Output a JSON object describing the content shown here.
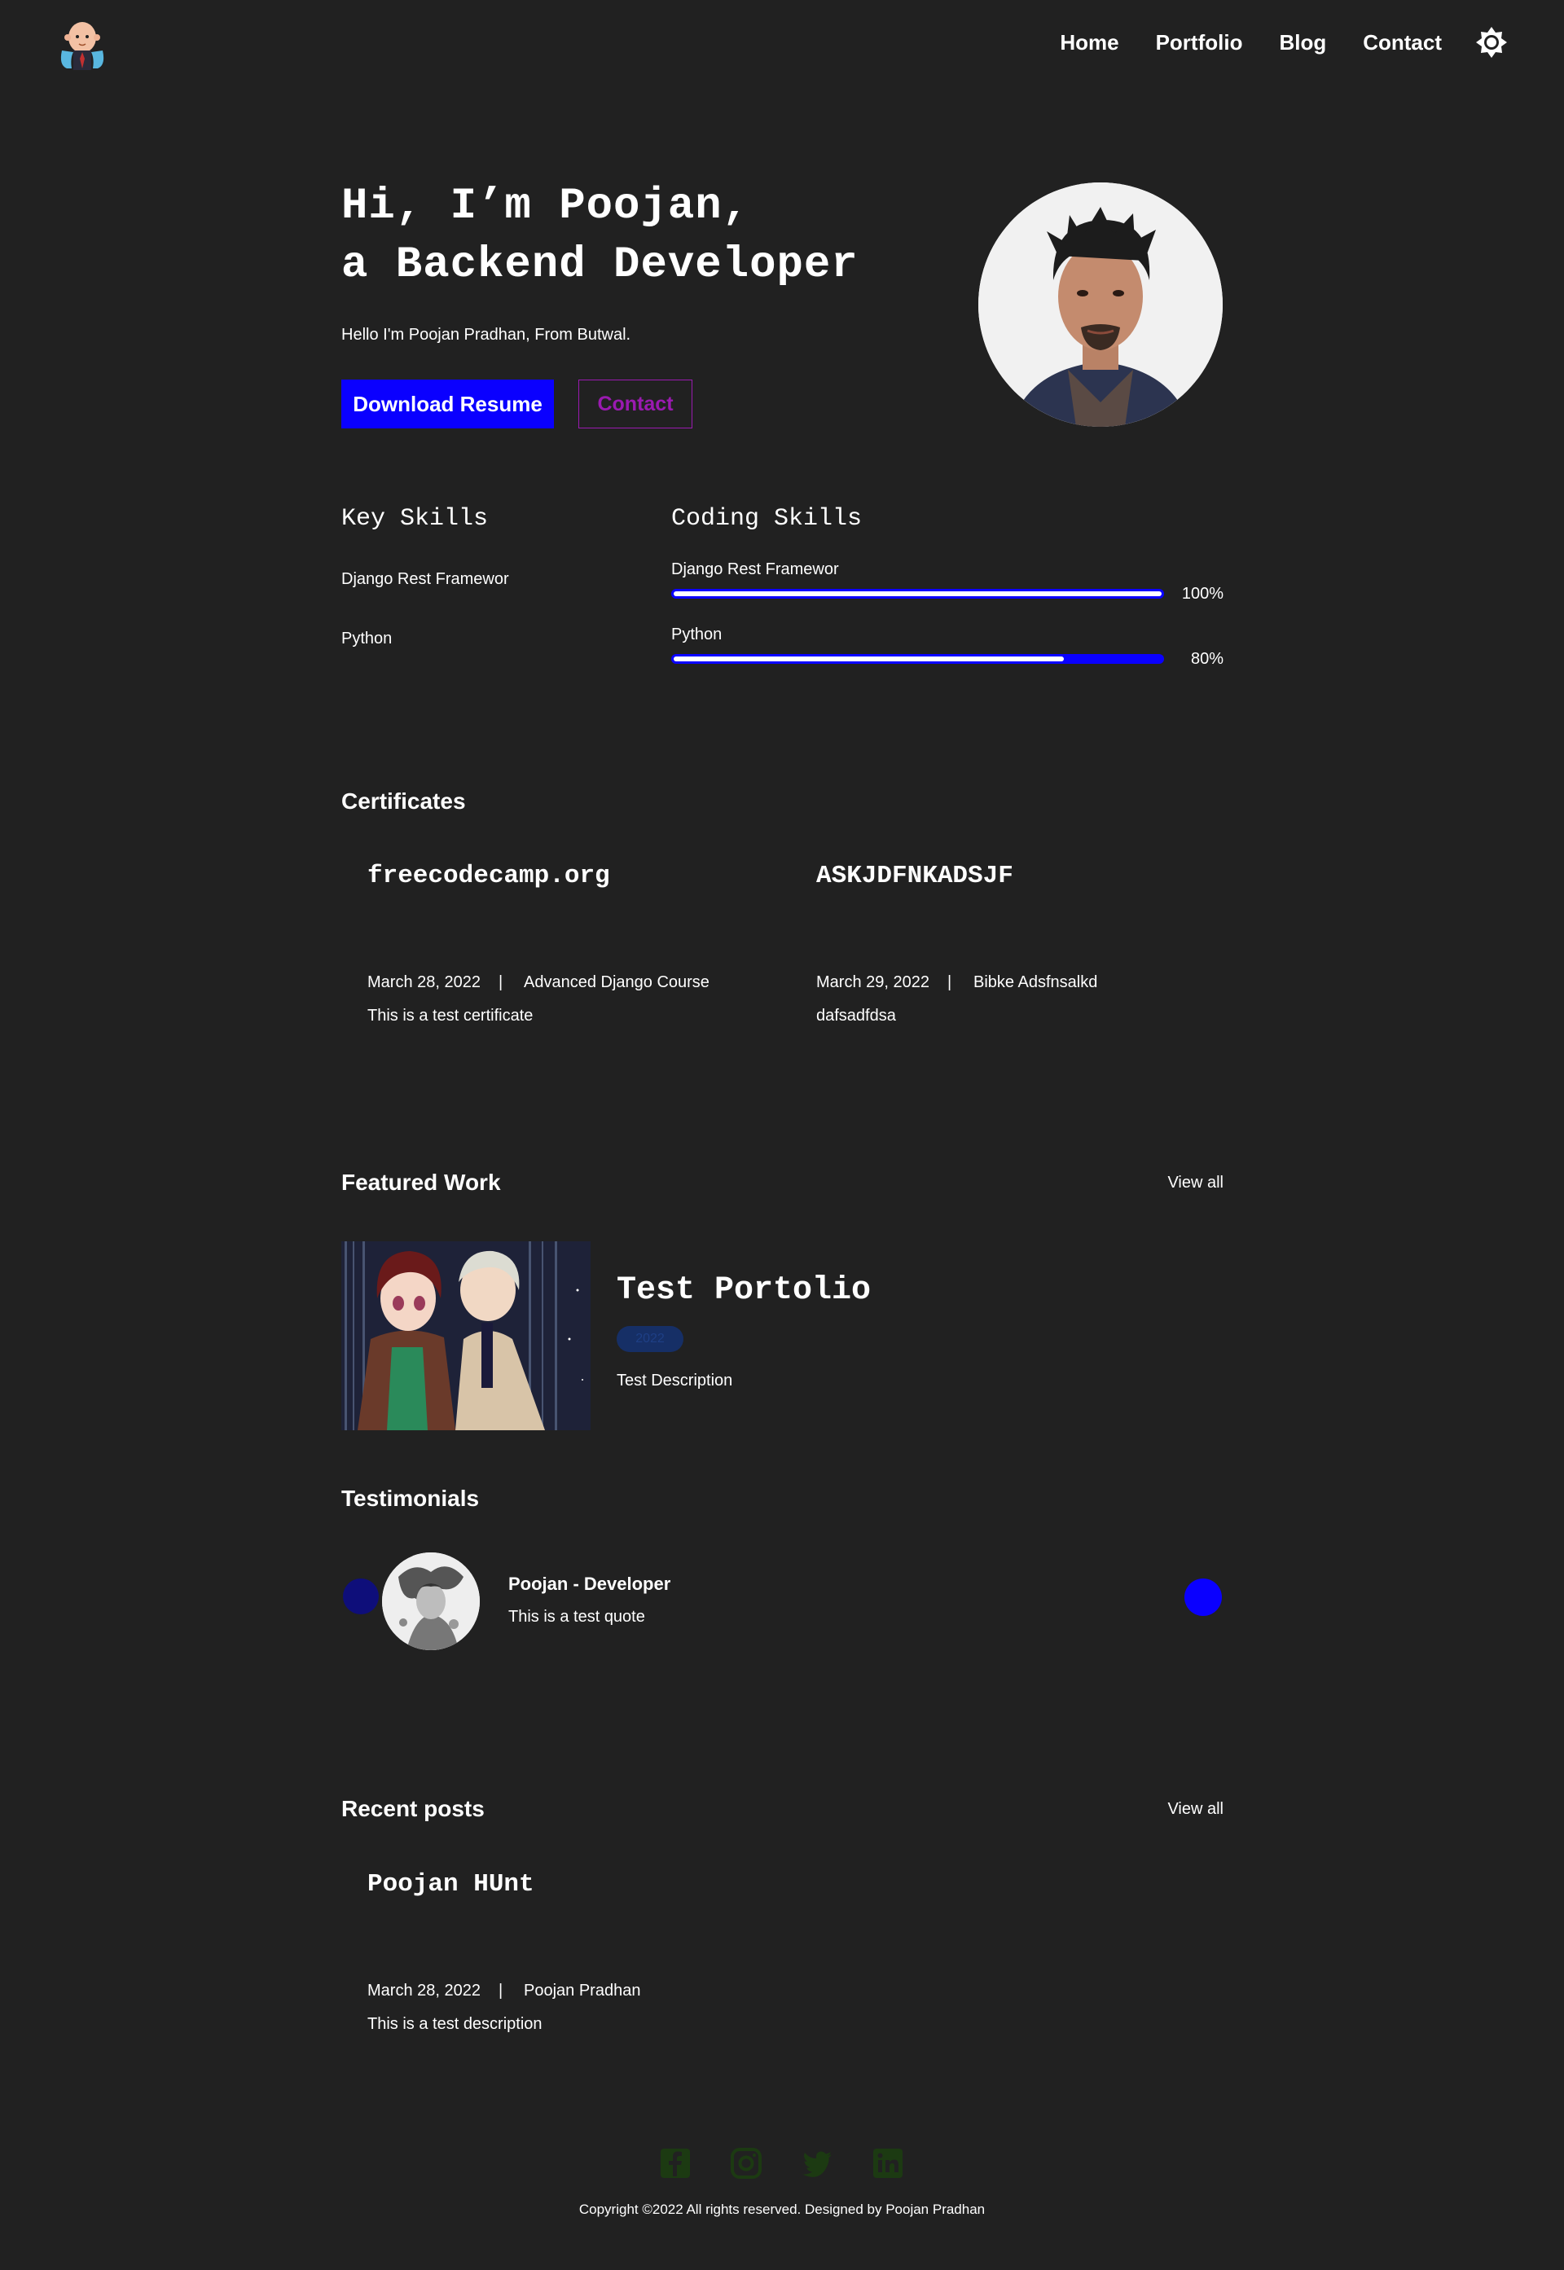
{
  "nav": {
    "items": [
      "Home",
      "Portfolio",
      "Blog",
      "Contact"
    ]
  },
  "hero": {
    "title_line1": "Hi, I’m Poojan,",
    "title_line2": "a Backend Developer",
    "subtitle": "Hello I'm Poojan Pradhan, From Butwal.",
    "resume_label": "Download Resume",
    "contact_label": "Contact"
  },
  "skills": {
    "key_heading": "Key Skills",
    "coding_heading": "Coding Skills",
    "key": [
      "Django Rest Framewor",
      "Python"
    ],
    "coding": [
      {
        "name": "Django Rest Framewor",
        "percent_label": "100%",
        "percent": 100
      },
      {
        "name": "Python",
        "percent_label": "80%",
        "percent": 80
      }
    ]
  },
  "certificates": {
    "heading": "Certificates",
    "items": [
      {
        "title": "freecodecamp.org",
        "date": "March 28, 2022",
        "course": "Advanced Django Course",
        "description": "This is a test certificate"
      },
      {
        "title": "ASKJDFNKADSJF",
        "date": "March 29, 2022",
        "course": "Bibke Adsfnsalkd",
        "description": "dafsadfdsa"
      }
    ]
  },
  "featured": {
    "heading": "Featured Work",
    "view_all": "View all",
    "title": "Test Portolio",
    "year": "2022",
    "description": "Test Description"
  },
  "testimonials": {
    "heading": "Testimonials",
    "name": "Poojan - Developer",
    "quote": "This is a test quote"
  },
  "posts": {
    "heading": "Recent posts",
    "view_all": "View all",
    "title": "Poojan HUnt",
    "date": "March 28, 2022",
    "author": "Poojan Pradhan",
    "description": "This is a test description"
  },
  "footer": {
    "social_icons": [
      "facebook-icon",
      "instagram-icon",
      "twitter-icon",
      "linkedin-icon"
    ],
    "social_color": "#1c3a12",
    "copyright": "Copyright ©2022 All rights reserved. Designed by Poojan Pradhan"
  },
  "colors": {
    "background": "#212121",
    "primary": "#0a00ff",
    "contact_outline": "#9a1ab0"
  }
}
